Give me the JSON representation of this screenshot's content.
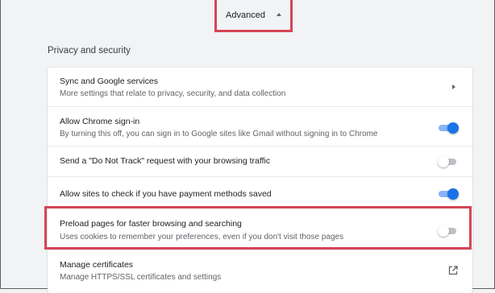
{
  "advanced": {
    "label": "Advanced"
  },
  "section": {
    "title": "Privacy and security"
  },
  "rows": [
    {
      "title": "Sync and Google services",
      "subtitle": "More settings that relate to privacy, security, and data collection",
      "control": "arrow"
    },
    {
      "title": "Allow Chrome sign-in",
      "subtitle": "By turning this off, you can sign in to Google sites like Gmail without signing in to Chrome",
      "control": "toggle",
      "checked": true
    },
    {
      "title": "Send a \"Do Not Track\" request with your browsing traffic",
      "control": "toggle",
      "checked": false
    },
    {
      "title": "Allow sites to check if you have payment methods saved",
      "control": "toggle",
      "checked": true
    },
    {
      "title": "Preload pages for faster browsing and searching",
      "subtitle": "Uses cookies to remember your preferences, even if you don't visit those pages",
      "control": "toggle",
      "checked": false
    },
    {
      "title": "Manage certificates",
      "subtitle": "Manage HTTPS/SSL certificates and settings",
      "control": "external-link"
    }
  ],
  "colors": {
    "accent": "#1a73e8",
    "highlight": "#d64455"
  },
  "icons": {
    "advanced": "caret-up-icon",
    "sync": "chevron-right-icon",
    "certificates": "external-link-icon"
  }
}
